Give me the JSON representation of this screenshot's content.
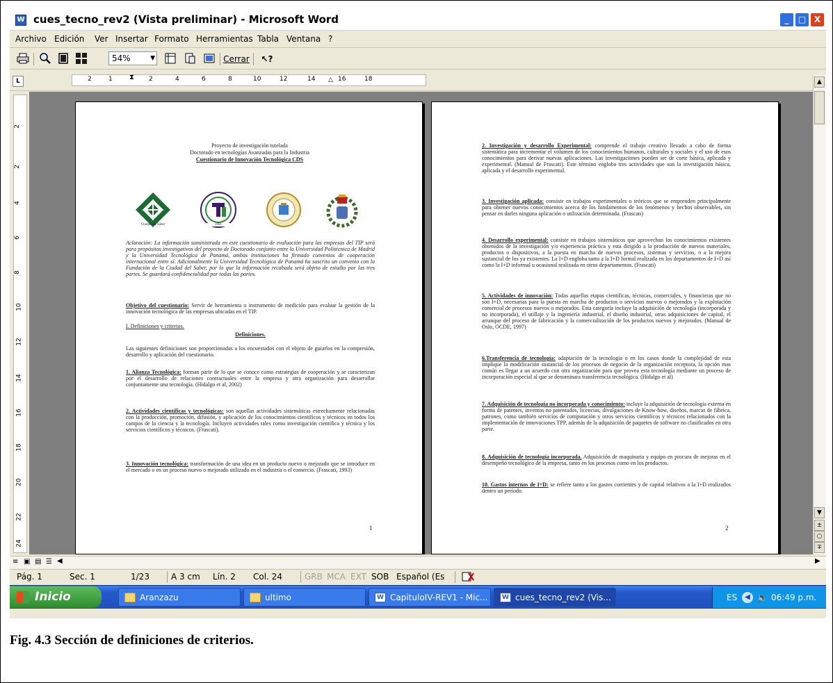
{
  "window": {
    "title": "cues_tecno_rev2 (Vista preliminar) - Microsoft Word",
    "app_icon": "W",
    "controls": {
      "minimize": "_",
      "maximize": "□",
      "close": "X"
    }
  },
  "menu": [
    "Archivo",
    "Edición",
    "Ver",
    "Insertar",
    "Formato",
    "Herramientas",
    "Tabla",
    "Ventana",
    "?"
  ],
  "toolbar": {
    "zoom_value": "54%",
    "close_label": "Cerrar",
    "icons": [
      "print-icon",
      "magnifier-icon",
      "one-page-icon",
      "multiple-pages-icon",
      "view-ruler-icon",
      "shrink-to-fit-icon",
      "full-screen-icon",
      "help-icon"
    ]
  },
  "ruler": {
    "horizontal_ticks": [
      "2",
      "1",
      "2",
      "4",
      "6",
      "8",
      "10",
      "12",
      "14",
      "16",
      "18"
    ],
    "vertical_ticks": [
      "2",
      "2",
      "4",
      "6",
      "8",
      "10",
      "12",
      "14",
      "16",
      "18",
      "20",
      "22",
      "24"
    ]
  },
  "page1": {
    "header_line1": "Proyecto de investigación tutelada",
    "header_line2": "Doctorado en tecnologías Avanzadas para la Industria",
    "header_line3": "Cuestionario de Innovación Tecnológica CDS",
    "logo1_caption": "Ciudad del Saber",
    "logo2_text": "UNIVERSIDAD TECNOLÓGICA DE PANAMÁ",
    "logo2_year": "1981",
    "aclaracion": "Aclaración: La información suministrada en este cuestionario de evaluación para las empresas del TIP será para propósitos investigativos del proyecto de Doctorado conjunto entre la Universidad Politécnica de Madrid y la Universidad Tecnológica de Panamá, ambas instituciones ha firmado convenios de cooperación internacional entre sí. Adicionalmente la Universidad Tecnológica de Panamá ha suscrito un convenio con la Fundación de la Ciudad del Saber, por lo que la información recabada será objeto de estudio por las tres partes. Se guardará confidencialidad por todas las partes.",
    "objetivo_label": "Objetivo del cuestionario:",
    "objetivo_text": "Servir de herramienta o instrumento de medición para evaluar la gestión de la innovación tecnológica de las empresas ubicadas en el TIP.",
    "section_heading": "I. Definiciones y criterios.",
    "definiciones": "Definiciones.",
    "intro": "Las siguientes definiciones son proporcionadas a los encuestados con el objeto de guiarlos en la compresión, desarrollo y aplicación del cuestionario.",
    "def1_label": "1. Alianza Tecnológica:",
    "def1_text": "forman parte de lo que se conoce como estrategias de cooperación y se caracterizan por el desarrollo de relaciones contractuales entre la empresa y otra organización para desarrollar conjuntamente una tecnología. (Hidalgo et al, 2002)",
    "def2_label": "2. Actividades científicas y tecnológicas:",
    "def2_text": "son aquellas actividades sistemáticas estrechamente relacionadas con la producción, promoción, difusión, y aplicación de los conocimientos científicos y técnicos en todos los campos de la ciencia y la tecnología. Incluyen actividades tales como investigación científica y técnica y los servicios científicos y técnicos. (Frascati).",
    "def3_label": "3. Innovación tecnológica:",
    "def3_text": "transformación de una idea en un producto nuevo o mejorado que se introduce en el mercado o en un proceso nuevo o mejorado utilizado en el industria o el comercio. (Frascati, 1993)",
    "page_number": "1"
  },
  "page2": {
    "def2_label": "2. Investigación y desarrollo Experimental:",
    "def2_text": "comprende el trabajo creativo llevado a cabo de forma sistemática para incrementar el volumen de los conocimientos humanos, culturales y sociales y el uso de esos conocimientos para derivar nuevas aplicaciones. Las investigaciones pueden ser de corte básica, aplicada y experimental. (Manual de Frascati). Este término engloba tres actividades que son la investigación básica, aplicada y el desarrollo experimental.",
    "def3_label": "3. Investigación aplicada:",
    "def3_text": "consiste en trabajos experimentales o teóricos que se emprenden principalmente para obtener nuevos conocimientos acerca de los fundamentos de los fenómenos y hechos observables, sin pensar en darles ninguna aplicación o utilización determinada. (Frascati)",
    "def4_label": "4. Desarrollo experimental:",
    "def4_text": "consiste en trabajos sistemáticos que aprovechan los conocimientos existentes obtenidos de la investigación y/o experiencia práctica y esta dirigido a la producción de nuevos materiales, productos o dispositivos, a la puesta en marcha de nuevos procesos, sistemas y servicios, o a la mejora sustancial de los ya existentes. La I+D engloba tanto a la I+D formal realizada en los departamentos de I+D así como la I+D informal u ocasional realizada en otros departamentos. (Frascati)",
    "def5_label": "5. Actividades de innovación:",
    "def5_text": "Todas aquellas etapas científicas, técnicas, comerciales, y financieras que no son I+D, necesarias para la puesta en marcha de productos o servicios nuevos o mejorados y la explotación comercial de procesos nuevos o mejorados. Esta categoría incluye la adquisición de tecnología (incorporada y no incorporada), el utillaje y la ingeniería industrial, el diseño industrial, otras adquisiciones de capital, el arranque del proceso de fabricación y la comercialización de los productos nuevos y mejorados. (Manual de Oslo, OCDE, 1997)",
    "def6_label": "6.Transferencia de tecnología:",
    "def6_text": "adaptación de la tecnología o en los casos donde la complejidad de esta implique la modificación sustancial de los procesos de negocio de la organización receptora, la opción mas común es llegar a un acuerdo con otra organización para que provea esta tecnología mediante un proceso de incorporación especial al que se denominara transferencia tecnológica. (Hidalgo et al)",
    "def7_label": "7. Adquisición de tecnología no incorporada y conocimiento:",
    "def7_text": "incluye la adquisición de tecnología externa en forma de patentes, inventos no patentados, licencias, divulgaciones de Know-how, diseños, marcas de fábrica, patrones, como también servicios de computación y otros servicios científicos y técnicos relacionados con la implementación de innovaciones TPP, además de la adquisición de paquetes de software no clasificados en otra parte.",
    "def8_label": "8. Adquisición de tecnología incorporada.",
    "def8_text": "Adquisición de maquinaria y equipo en procura de mejoras en el desempeño tecnológico de la empresa, tanto en los procesos como en los productos.",
    "def10_label": "10. Gastos internos de I+D:",
    "def10_text": "se refiere tanto a los gastos corrientes y de capital relativos a la I+D realizados dentro un período.",
    "page_number": "2"
  },
  "status": {
    "pag": "Pág. 1",
    "sec": "Sec. 1",
    "pages": "1/23",
    "at": "A 3 cm",
    "line": "Lín. 2",
    "col": "Col. 24",
    "grb": "GRB",
    "mca": "MCA",
    "ext": "EXT",
    "sob": "SOB",
    "lang": "Español (Es"
  },
  "taskbar": {
    "start": "Inicio",
    "tasks": [
      "Aranzazu",
      "ultimo",
      "CapituloIV-REV1 - Mic...",
      "cues_tecno_rev2 (Vis..."
    ],
    "tray_lang": "ES",
    "clock": "06:49 p.m."
  },
  "caption": "Fig. 4.3 Sección de definiciones de criterios.",
  "colors": {
    "taskbar": "#2458c8",
    "start": "#2e8b2e",
    "close": "#d9411e",
    "viewport": "#7f7f7f"
  }
}
